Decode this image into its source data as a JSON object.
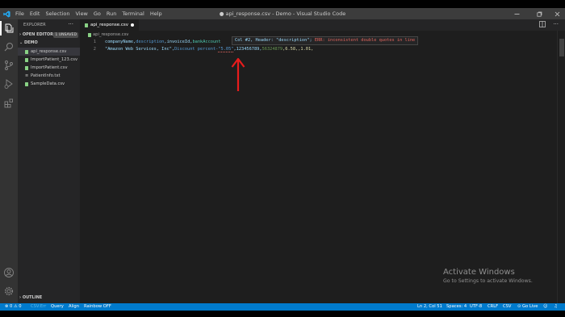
{
  "window": {
    "title": "● api_response.csv - Demo - Visual Studio Code",
    "menu": [
      "File",
      "Edit",
      "Selection",
      "View",
      "Go",
      "Run",
      "Terminal",
      "Help"
    ]
  },
  "sidebar": {
    "title": "EXPLORER",
    "more": "···",
    "open_editors": "OPEN EDITORS",
    "unsaved_badge": "1 UNSAVED",
    "folder": "DEMO",
    "files": [
      {
        "name": "api_response.csv",
        "type": "csv",
        "active": true
      },
      {
        "name": "ImportPatient_123.csv",
        "type": "csv"
      },
      {
        "name": "ImportPatient.csv",
        "type": "csv"
      },
      {
        "name": "PatientInfo.txt",
        "type": "txt"
      },
      {
        "name": "SampleData.csv",
        "type": "csv"
      }
    ],
    "outline": "OUTLINE"
  },
  "tab": {
    "label": "api_response.csv"
  },
  "breadcrumb": {
    "file": "api_response.csv"
  },
  "editor": {
    "line_numbers": [
      "1",
      "2"
    ],
    "line1": {
      "a": "companyName,",
      "b": "description",
      "c": ",invoiceId,",
      "d": "bankAccount"
    },
    "line2": {
      "a": "\"Amazon Web Services, Inc\",",
      "b": "Discount percent-",
      "c": "\"5.05\"",
      "d": ",123456789,",
      "e": "56324879",
      "f": ",6.58,,1.01,"
    }
  },
  "hover": {
    "info": "Col #2, Header: \"description\";",
    "error": "ERR: inconsistent double quotes in line"
  },
  "activation": {
    "title": "Activate Windows",
    "subtitle": "Go to Settings to activate Windows."
  },
  "statusbar": {
    "errors": "⊗ 0 ⚠ 0",
    "extra": "CSV:Err",
    "query": "Query",
    "align": "Align",
    "rainbow": "Rainbow OFF",
    "position": "Ln 2, Col 51",
    "spaces": "Spaces: 4",
    "encoding": "UTF-8",
    "eol": "CRLF",
    "language": "CSV",
    "golive": "⊙ Go Live"
  },
  "colors": {
    "accent": "#007acc",
    "arrow": "#e81c1c",
    "error": "#e3665e"
  }
}
